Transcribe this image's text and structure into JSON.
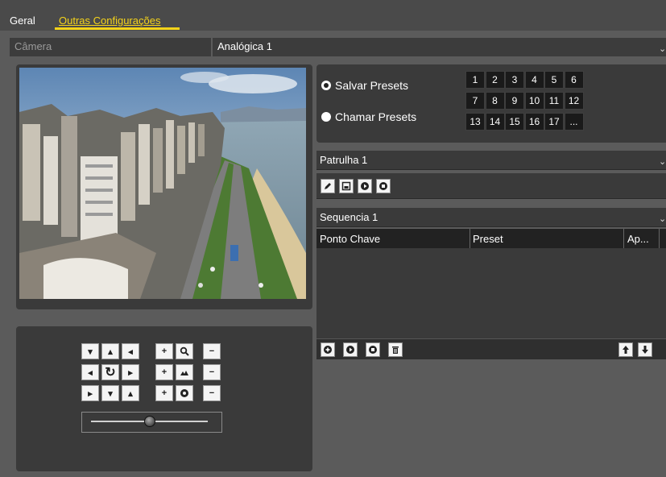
{
  "tabs": [
    {
      "label": "Geral"
    },
    {
      "label": "Outras Configurações"
    }
  ],
  "camera": {
    "label": "Câmera",
    "value": "Analógica 1"
  },
  "presets": {
    "save_label": "Salvar Presets",
    "call_label": "Chamar Presets",
    "selected": "save",
    "numbers": [
      "1",
      "2",
      "3",
      "4",
      "5",
      "6",
      "7",
      "8",
      "9",
      "10",
      "11",
      "12",
      "13",
      "14",
      "15",
      "16",
      "17",
      "..."
    ]
  },
  "patrol": {
    "value": "Patrulha 1"
  },
  "sequence": {
    "value": "Sequencia 1",
    "columns": [
      "Ponto Chave",
      "Preset",
      "Ap..."
    ],
    "rows": []
  },
  "ptz": {
    "row1": [
      "▾",
      "▴",
      "◂",
      "+",
      "zoom",
      "−"
    ],
    "zoom_plus": "+",
    "minus": "−"
  },
  "colors": {
    "accent": "#f5d31a",
    "panel": "#3a3a3a",
    "background": "#5b5b5b"
  }
}
